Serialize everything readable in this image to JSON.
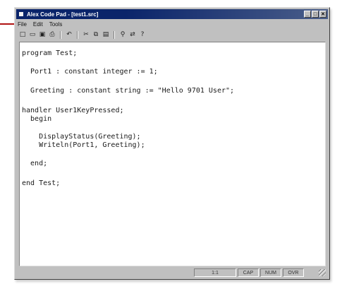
{
  "window": {
    "title": "Alex Code Pad - [test1.src]",
    "controls": {
      "minimize": "_",
      "maximize": "□",
      "close": "✕"
    }
  },
  "menu": {
    "items": [
      "File",
      "Edit",
      "Tools"
    ]
  },
  "toolbar": {
    "buttons": [
      {
        "name": "new-file-icon",
        "glyph": "□"
      },
      {
        "name": "open-file-icon",
        "glyph": "▭"
      },
      {
        "name": "save-icon",
        "glyph": "▣"
      },
      {
        "name": "print-icon",
        "glyph": "⎙"
      },
      {
        "name": "undo-icon",
        "glyph": "↶"
      },
      {
        "name": "cut-icon",
        "glyph": "✂"
      },
      {
        "name": "copy-icon",
        "glyph": "⧉"
      },
      {
        "name": "paste-icon",
        "glyph": "▤"
      },
      {
        "name": "find-icon",
        "glyph": "⚲"
      },
      {
        "name": "replace-icon",
        "glyph": "⇄"
      },
      {
        "name": "help-icon",
        "glyph": "?"
      }
    ]
  },
  "editor": {
    "lines": [
      "program Test;",
      "  Port1 : constant integer := 1;",
      "  Greeting : constant string := \"Hello 9701 User\";",
      "handler User1KeyPressed;",
      "  begin",
      "    DisplayStatus(Greeting);",
      "    Writeln(Port1, Greeting);",
      "  end;",
      "end Test;"
    ]
  },
  "statusbar": {
    "position": "1:1",
    "cap": "CAP",
    "num": "NUM",
    "ovr": "OVR"
  },
  "colors": {
    "titlebar": "#0a246a",
    "window_face": "#c0c0c0",
    "accent_line": "#b01212"
  }
}
